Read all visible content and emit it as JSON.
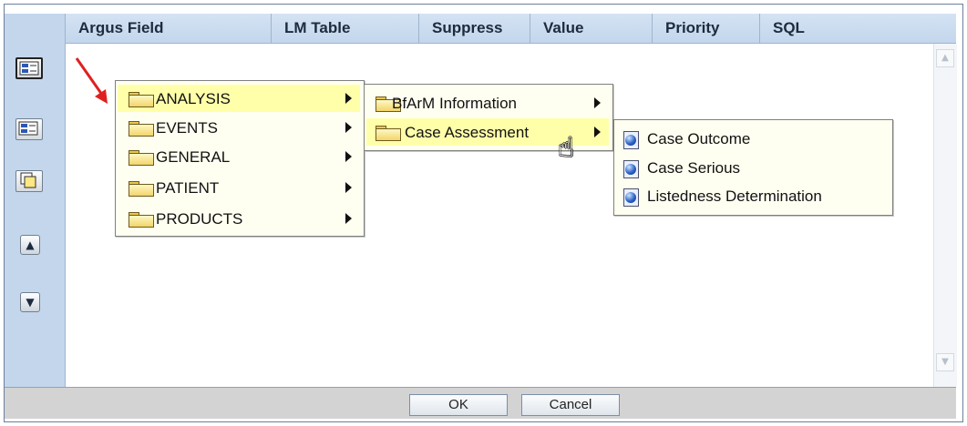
{
  "columns": [
    "Argus Field",
    "LM Table",
    "Suppress",
    "Value",
    "Priority",
    "SQL"
  ],
  "toolbar": {
    "btn1": "select-field-icon",
    "btn2": "field-list-icon",
    "btn3": "copy-icon",
    "up": "▲",
    "down": "▼"
  },
  "menu1": [
    "ANALYSIS",
    "EVENTS",
    "GENERAL",
    "PATIENT",
    "PRODUCTS"
  ],
  "menu2": [
    "BfArM Information",
    "Case Assessment"
  ],
  "menu3": [
    "Case Outcome",
    "Case Serious",
    "Listedness Determination"
  ],
  "footer": {
    "ok": "OK",
    "cancel": "Cancel"
  },
  "colors": {
    "header": "#c3d6ec",
    "menu_bg": "#fffff1",
    "highlight": "#ffffaa",
    "footer": "#d3d3d3"
  }
}
